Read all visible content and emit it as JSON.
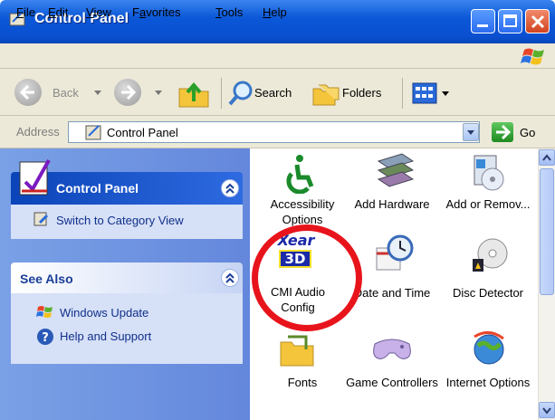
{
  "window": {
    "title": "Control Panel",
    "buttons": {
      "minimize": "minimize",
      "maximize": "maximize",
      "close": "close"
    }
  },
  "menubar": {
    "items": [
      {
        "label": "File",
        "key": "F",
        "rest": "ile"
      },
      {
        "label": "Edit",
        "key": "E",
        "rest": "dit"
      },
      {
        "label": "View",
        "key": "V",
        "rest": "iew"
      },
      {
        "label": "Favorites",
        "key": "a",
        "pre": "F",
        "rest": "vorites"
      },
      {
        "label": "Tools",
        "key": "T",
        "rest": "ools"
      },
      {
        "label": "Help",
        "key": "H",
        "rest": "elp"
      }
    ]
  },
  "toolbar": {
    "back_label": "Back",
    "search_label": "Search",
    "folders_label": "Folders"
  },
  "address": {
    "label": "Address",
    "value": "Control Panel",
    "go_label": "Go"
  },
  "leftpane": {
    "control_panel": {
      "title": "Control Panel",
      "link": "Switch to Category View"
    },
    "see_also": {
      "title": "See Also",
      "links": [
        "Windows Update",
        "Help and Support"
      ]
    }
  },
  "content": {
    "items": [
      {
        "label": "Accessibility Options",
        "icon": "accessibility-icon"
      },
      {
        "label": "Add Hardware",
        "icon": "hardware-icon"
      },
      {
        "label": "Add or Remov...",
        "icon": "add-remove-icon"
      },
      {
        "label": "CMI Audio Config",
        "icon": "xear-3d-icon",
        "logo_text": [
          "Xear",
          "3D"
        ]
      },
      {
        "label": "Date and Time",
        "icon": "clock-icon"
      },
      {
        "label": "Disc Detector",
        "icon": "disc-icon"
      },
      {
        "label": "Fonts",
        "icon": "fonts-folder-icon"
      },
      {
        "label": "Game Controllers",
        "icon": "gamepad-icon"
      },
      {
        "label": "Internet Options",
        "icon": "globe-icon"
      }
    ]
  },
  "colors": {
    "title_blue": "#0b58d8",
    "highlight_red": "#e8141c",
    "left_pane_blue": "#6f96e2"
  }
}
